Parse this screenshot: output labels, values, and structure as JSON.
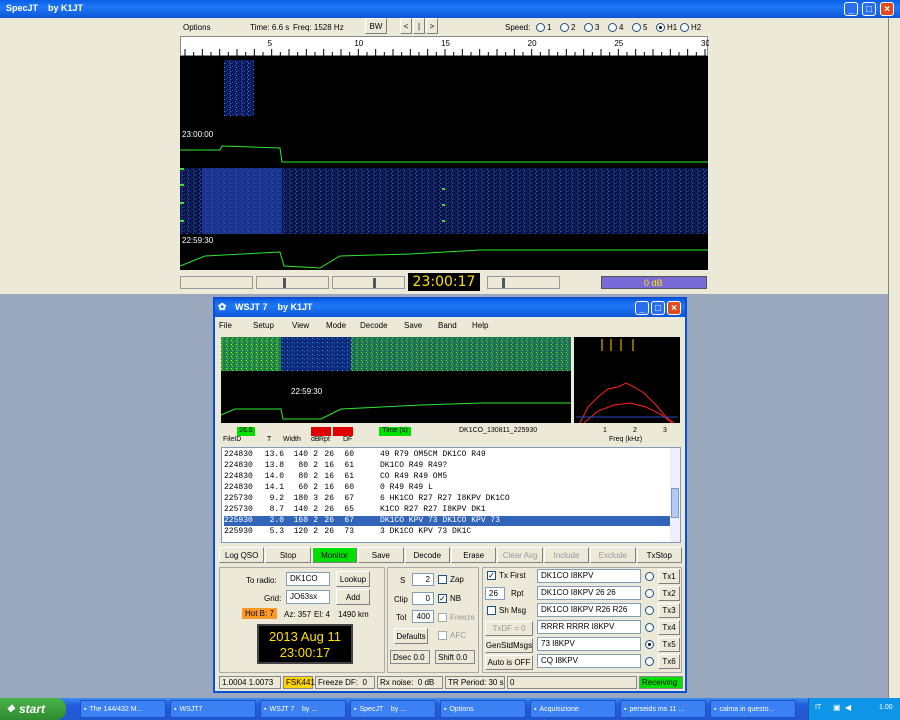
{
  "specjt": {
    "title": "SpecJT    by K1JT",
    "options_label": "Options",
    "time_label": "Time: 6.6 s",
    "freq_label": "Freq: 1528 Hz",
    "bw_button": "BW",
    "nav_left": "<",
    "nav_mid": "|",
    "nav_right": ">",
    "speed_label": "Speed:",
    "speeds": [
      "1",
      "2",
      "3",
      "4",
      "5",
      "H1",
      "H2"
    ],
    "speed_selected": "H1",
    "scale_labels": [
      "5",
      "10",
      "15",
      "20",
      "25",
      "30"
    ],
    "time_mark_top": "23:00:00",
    "time_mark_bottom": "22:59:30",
    "clock": "23:00:17",
    "level_readout": "0 dB"
  },
  "wsjt": {
    "title": "WSJT 7    by K1JT",
    "menu": [
      "File",
      "Setup",
      "View",
      "Mode",
      "Decode",
      "Save",
      "Band",
      "Help"
    ],
    "wf_time_label": "22:59:30",
    "status_chips": [
      "26.6",
      "",
      "",
      "Time (s)"
    ],
    "filename": "DK1CO_130811_225930",
    "freq_ticks": [
      "1",
      "2",
      "3"
    ],
    "freq_label": "Freq (kHz)",
    "col_headers": [
      "FileID",
      "T",
      "Width",
      "dB",
      "Rpt",
      "DF"
    ],
    "rows": [
      {
        "id": "224830",
        "t": "13.6",
        "w": "140",
        "db": "2",
        "rpt": "26",
        "df": "60",
        "msg": "49 R79 OM5CM DK1CO R49"
      },
      {
        "id": "224830",
        "t": "13.8",
        "w": "80",
        "db": "2",
        "rpt": "16",
        "df": "61",
        "msg": "DK1CO R49 R49?"
      },
      {
        "id": "224830",
        "t": "14.0",
        "w": "80",
        "db": "2",
        "rpt": "16",
        "df": "61",
        "msg": "CO R49 R49 OM5"
      },
      {
        "id": "224830",
        "t": "14.1",
        "w": "60",
        "db": "2",
        "rpt": "16",
        "df": "60",
        "msg": "0 R49 R49 L"
      },
      {
        "id": "225730",
        "t": "9.2",
        "w": "180",
        "db": "3",
        "rpt": "26",
        "df": "67",
        "msg": "6 HK1CO R27 R27 I8KPV DK1CO"
      },
      {
        "id": "225730",
        "t": "8.7",
        "w": "140",
        "db": "2",
        "rpt": "26",
        "df": "65",
        "msg": "K1CO R27 R27 I8KPV DK1"
      },
      {
        "id": "225930",
        "t": "2.0",
        "w": "160",
        "db": "2",
        "rpt": "26",
        "df": "67",
        "msg": "DK1CO KPV 73 DK1CO KPV 73"
      },
      {
        "id": "225930",
        "t": "5.3",
        "w": "120",
        "db": "2",
        "rpt": "26",
        "df": "73",
        "msg": "3 DK1CO KPV 73 DK1C"
      }
    ],
    "selected_row": 6,
    "buttons": [
      "Log QSO",
      "Stop",
      "Monitor",
      "Save",
      "Decode",
      "Erase",
      "Clear Avg",
      "Include",
      "Exclude",
      "TxStop"
    ],
    "to_radio_label": "To radio:",
    "to_radio": "DK1CO",
    "lookup": "Lookup",
    "grid_label": "Grid:",
    "grid": "JO63sx",
    "add": "Add",
    "hotb": "Hot B: 7",
    "az": "Az: 357",
    "el": "El: 4",
    "dist": "1490 km",
    "date": "2013 Aug 11",
    "time": "23:00:17",
    "s_label": "S",
    "s_val": "2",
    "clip_label": "Clip",
    "clip_val": "0",
    "tol_label": "Tol",
    "tol_val": "400",
    "defaults": "Defaults",
    "dsec_label": "Dsec",
    "dsec_val": "0.0",
    "shift_label": "Shift",
    "shift_val": "0.0",
    "zap": "Zap",
    "nb": "NB",
    "freeze": "Freeze",
    "afc": "AFC",
    "txfirst": "Tx First",
    "rpt_val": "26",
    "rpt_label": "Rpt",
    "shmsg": "Sh Msg",
    "txdf": "TxDF = 0",
    "genstd": "GenStdMsgs",
    "auto": "Auto is OFF",
    "tx_msgs": [
      "DK1CO I8KPV",
      "DK1CO I8KPV 26 26",
      "DK1CO I8KPV R26 R26",
      "RRRR RRRR I8KPV",
      "73 I8KPV",
      "CQ I8KPV"
    ],
    "tx_labels": [
      "Tx1",
      "Tx2",
      "Tx3",
      "Tx4",
      "Tx5",
      "Tx6"
    ],
    "tx_selected": 4,
    "sb_values": "1.0004 1.0073",
    "sb_mode": "FSK441",
    "sb_freeze": "Freeze DF:  0",
    "sb_rx": "Rx noise:  0 dB",
    "sb_tr": "TR Period: 30 s",
    "sb_zero": "0",
    "sb_status": "Receiving"
  },
  "bg_options": "Options",
  "taskbar": {
    "start": "start",
    "items": [
      "The 144/432 M...",
      "WSJT7",
      "WSJT 7    by ...",
      "SpecJT    by ...",
      "Options",
      "Acquisizione",
      "perseids ms 11 ...",
      "calma in questo..."
    ],
    "lang": "IT",
    "clock": "1.00"
  },
  "colors": {
    "xp_blue": "#1f78f5",
    "bg": "#9aa8bd",
    "monitor_green": "#00e000",
    "select_blue": "#3265b8"
  }
}
